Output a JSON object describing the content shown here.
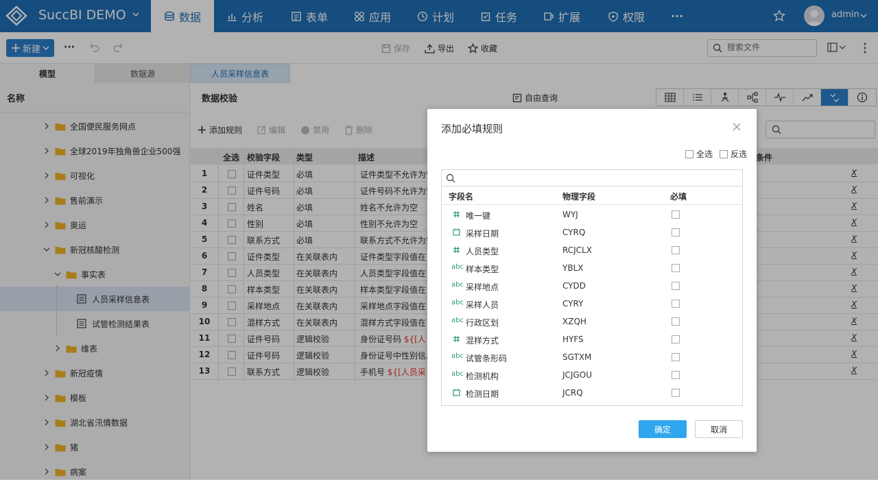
{
  "app": {
    "title": "SuccBI DEMO"
  },
  "nav": {
    "items": [
      "数据",
      "分析",
      "表单",
      "应用",
      "计划",
      "任务",
      "扩展",
      "权限"
    ],
    "more": "···"
  },
  "user": {
    "name": "admin"
  },
  "toolbar": {
    "new_label": "新建",
    "more": "···",
    "save": "保存",
    "export": "导出",
    "favorite": "收藏",
    "search_placeholder": "搜索文件"
  },
  "tabs": {
    "model": "模型",
    "datasource": "数据源",
    "open": "人员采样信息表"
  },
  "tree": {
    "header": "名称",
    "items": [
      {
        "label": "全国便民服务网点"
      },
      {
        "label": "全球2019年独角兽企业500强"
      },
      {
        "label": "可视化"
      },
      {
        "label": "售前演示"
      },
      {
        "label": "奥运"
      },
      {
        "label": "新冠核酸检测"
      },
      {
        "label": "事实表"
      },
      {
        "label": "人员采样信息表"
      },
      {
        "label": "试管检测结果表"
      },
      {
        "label": "维表"
      },
      {
        "label": "新冠疫情"
      },
      {
        "label": "模板"
      },
      {
        "label": "湖北省汛情数据"
      },
      {
        "label": "猪"
      },
      {
        "label": "病案"
      }
    ]
  },
  "main": {
    "title": "数据校验",
    "free_query": "自由查询",
    "actions": {
      "add": "添加规则",
      "edit": "编辑",
      "disable": "禁用",
      "delete": "删除"
    },
    "columns": {
      "select_all": "全选",
      "field": "校验字段",
      "type": "类型",
      "desc": "描述",
      "condition": "条件"
    },
    "rows": [
      {
        "num": "1",
        "field": "证件类型",
        "type": "必填",
        "desc": "证件类型不允许为空"
      },
      {
        "num": "2",
        "field": "证件号码",
        "type": "必填",
        "desc": "证件号码不允许为空"
      },
      {
        "num": "3",
        "field": "姓名",
        "type": "必填",
        "desc": "姓名不允许为空"
      },
      {
        "num": "4",
        "field": "性别",
        "type": "必填",
        "desc": "性别不允许为空"
      },
      {
        "num": "5",
        "field": "联系方式",
        "type": "必填",
        "desc": "联系方式不允许为空"
      },
      {
        "num": "6",
        "field": "证件类型",
        "type": "在关联表内",
        "desc": "证件类型字段值在"
      },
      {
        "num": "7",
        "field": "人员类型",
        "type": "在关联表内",
        "desc": "人员类型字段值在"
      },
      {
        "num": "8",
        "field": "样本类型",
        "type": "在关联表内",
        "desc": "样本类型字段值在"
      },
      {
        "num": "9",
        "field": "采样地点",
        "type": "在关联表内",
        "desc": "采样地点字段值在"
      },
      {
        "num": "10",
        "field": "混样方式",
        "type": "在关联表内",
        "desc": "混样方式字段值在"
      },
      {
        "num": "11",
        "field": "证件号码",
        "type": "逻辑校验",
        "desc": "身份证号码",
        "var": "${[人"
      },
      {
        "num": "12",
        "field": "证件号码",
        "type": "逻辑校验",
        "desc": "身份证号中性别信息"
      },
      {
        "num": "13",
        "field": "联系方式",
        "type": "逻辑校验",
        "desc": "手机号",
        "var": "${[人员采"
      }
    ],
    "delete_mark": "X"
  },
  "dialog": {
    "title": "添加必填规则",
    "select_all": "全选",
    "invert": "反选",
    "columns": {
      "name": "字段名",
      "physical": "物理字段",
      "required": "必填"
    },
    "fields": [
      {
        "icon": "number",
        "name": "唯一键",
        "physical": "WYJ"
      },
      {
        "icon": "date",
        "name": "采样日期",
        "physical": "CYRQ"
      },
      {
        "icon": "number",
        "name": "人员类型",
        "physical": "RCJCLX"
      },
      {
        "icon": "text",
        "name": "样本类型",
        "physical": "YBLX"
      },
      {
        "icon": "text",
        "name": "采样地点",
        "physical": "CYDD"
      },
      {
        "icon": "text",
        "name": "采样人员",
        "physical": "CYRY"
      },
      {
        "icon": "text",
        "name": "行政区划",
        "physical": "XZQH"
      },
      {
        "icon": "number",
        "name": "混样方式",
        "physical": "HYFS"
      },
      {
        "icon": "text",
        "name": "试管条形码",
        "physical": "SGTXM"
      },
      {
        "icon": "text",
        "name": "检测机构",
        "physical": "JCJGOU"
      },
      {
        "icon": "date",
        "name": "检测日期",
        "physical": "JCRQ"
      }
    ],
    "text_icon_label": "abc",
    "ok": "确定",
    "cancel": "取消"
  },
  "colors": {
    "header": "#1f6fb5",
    "accent": "#2b7fcb",
    "ok": "#2fa6ee",
    "field_icon": "#2a9d6e"
  }
}
